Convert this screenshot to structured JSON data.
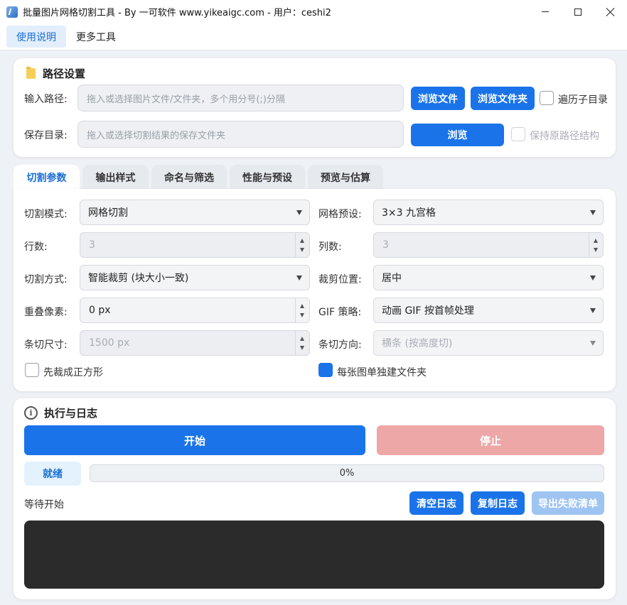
{
  "window": {
    "title": "批量图片网格切割工具 - By 一可软件 www.yikeaigc.com  -  用户：ceshi2"
  },
  "menu": [
    {
      "label": "使用说明",
      "active": true
    },
    {
      "label": "更多工具",
      "active": false
    }
  ],
  "path_settings": {
    "title": "路径设置",
    "input_label": "输入路径:",
    "input_placeholder": "拖入或选择图片文件/文件夹，多个用分号(;)分隔",
    "browse_file": "浏览文件",
    "browse_folder": "浏览文件夹",
    "recurse_label": "遍历子目录",
    "save_label": "保存目录:",
    "save_placeholder": "拖入或选择切割结果的保存文件夹",
    "browse": "浏览",
    "keep_structure_label": "保持原路径结构"
  },
  "tabs": [
    {
      "label": "切割参数",
      "active": true
    },
    {
      "label": "输出样式",
      "active": false
    },
    {
      "label": "命名与筛选",
      "active": false
    },
    {
      "label": "性能与预设",
      "active": false
    },
    {
      "label": "预览与估算",
      "active": false
    }
  ],
  "params": {
    "cut_mode_label": "切割模式:",
    "cut_mode_value": "网格切割",
    "grid_preset_label": "网格预设:",
    "grid_preset_value": "3×3 九宫格",
    "rows_label": "行数:",
    "rows_value": "3",
    "cols_label": "列数:",
    "cols_value": "3",
    "cut_method_label": "切割方式:",
    "cut_method_value": "智能裁剪 (块大小一致)",
    "crop_pos_label": "裁剪位置:",
    "crop_pos_value": "居中",
    "overlap_label": "重叠像素:",
    "overlap_value": "0 px",
    "gif_label": "GIF 策略:",
    "gif_value": "动画 GIF 按首帧处理",
    "strip_size_label": "条切尺寸:",
    "strip_size_value": "1500 px",
    "strip_dir_label": "条切方向:",
    "strip_dir_value": "横条 (按高度切)",
    "square_first_label": "先裁成正方形",
    "per_image_folder_label": "每张图单独建文件夹",
    "per_image_folder_checked": true,
    "square_first_checked": false
  },
  "execution": {
    "title": "执行与日志",
    "start": "开始",
    "stop": "停止",
    "status": "就绪",
    "progress_text": "0%",
    "progress_value": 0,
    "waiting": "等待开始",
    "clear_log": "清空日志",
    "copy_log": "复制日志",
    "export_failed": "导出失败清单"
  },
  "colors": {
    "primary": "#1a73e8",
    "stop_disabled": "#eea7a7",
    "log_bg": "#2b2b2b"
  }
}
